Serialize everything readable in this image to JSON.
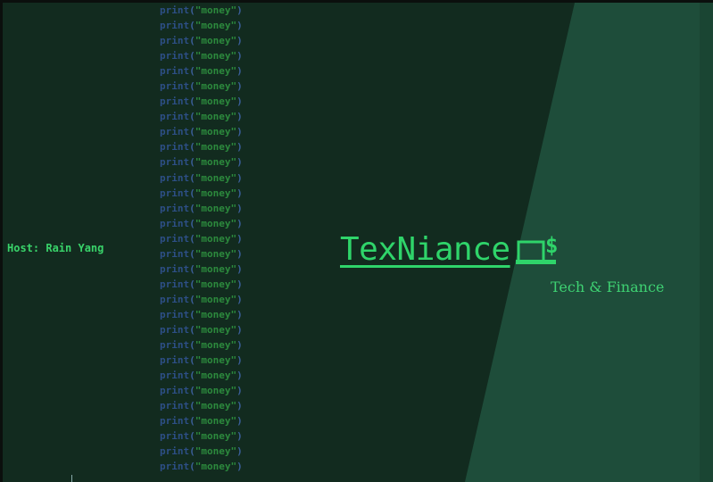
{
  "host_label": "Host: Rain Yang",
  "brand": {
    "name": "TexNiance",
    "tagline": "Tech & Finance",
    "icon": "laptop-dollar-icon"
  },
  "code_background": {
    "keyword": "print",
    "open": "(",
    "string": "\"money\"",
    "close": ")",
    "line_count": 31
  },
  "colors": {
    "background": "#122b1f",
    "diagonal_panel": "#1e4d3a",
    "brand_green": "#2fd46a",
    "code_keyword": "#2d4f86",
    "code_string": "#2c8a3d"
  }
}
